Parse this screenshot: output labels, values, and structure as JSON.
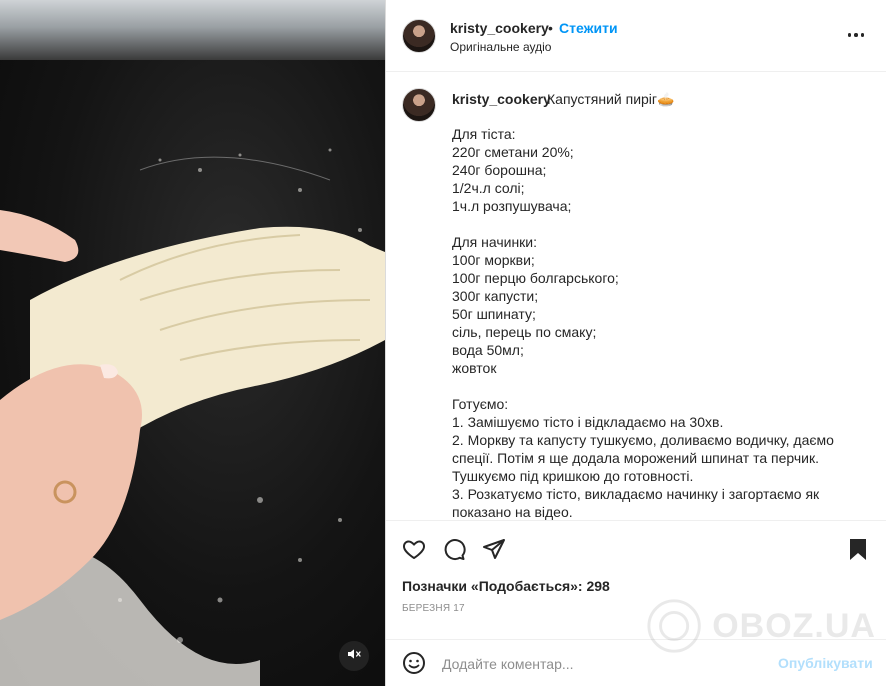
{
  "post": {
    "username": "kristy_cookery",
    "separator": "•",
    "follow_label": "Стежити",
    "audio_label": "Оригінальне аудіо",
    "caption_title": "Капустяний пиріг🥧",
    "caption_lines": [
      "Для тіста:",
      "220г сметани 20%;",
      "240г борошна;",
      "1/2ч.л солі;",
      "1ч.л розпушувача;",
      "",
      "Для начинки:",
      "100г моркви;",
      "100г перцю болгарського;",
      "300г капусти;",
      "50г шпинату;",
      "сіль, перець по смаку;",
      "вода 50мл;",
      "жовток",
      "",
      "Готуємо:",
      "1. Замішуємо тісто і відкладаємо на 30хв.",
      "2. Моркву та капусту тушкуємо, доливаємо водичку, даємо спеції. Потім я ще додала морожений шпинат та перчик. Тушкуємо під кришкою до готовності.",
      "3. Розкатуємо тісто, викладаємо начинку і загортаємо як показано на відео."
    ],
    "likes_text": "Позначки «Подобається»: 298",
    "date": "БЕРЕЗНЯ 17",
    "comment_placeholder": "Додайте коментар...",
    "publish_label": "Опублікувати"
  },
  "icons": {
    "like": "heart-icon",
    "comment": "comment-icon",
    "share": "send-icon",
    "save": "bookmark-icon",
    "emoji": "emoji-icon",
    "more": "more-icon",
    "mute": "muted-speaker-icon"
  },
  "watermark": {
    "text": "OBOZ.UA"
  },
  "colors": {
    "link": "#0095f6",
    "publish_disabled": "#b2dffc",
    "secondary_text": "#8e8e8e"
  }
}
